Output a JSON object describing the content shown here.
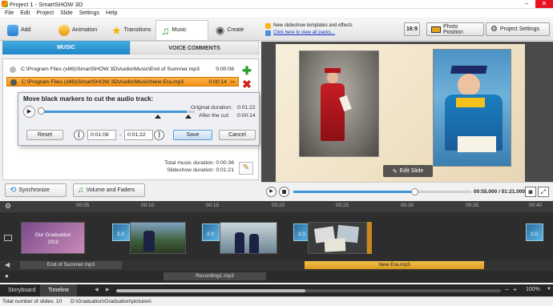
{
  "window": {
    "title": "Project 1 - SmartSHOW 3D",
    "minimize": "–",
    "close": "✕"
  },
  "menu": [
    "File",
    "Edit",
    "Project",
    "Slide",
    "Settings",
    "Help"
  ],
  "left_tabs": [
    {
      "label": "Add",
      "icon": "add-icon"
    },
    {
      "label": "Animation",
      "icon": "animation-icon"
    },
    {
      "label": "Transitions",
      "icon": "transitions-icon"
    },
    {
      "label": "Music",
      "icon": "music-icon"
    },
    {
      "label": "Create",
      "icon": "create-icon"
    }
  ],
  "subtabs": {
    "music": "MUSIC",
    "voice": "VOICE COMMENTS"
  },
  "tracks": [
    {
      "path": "C:\\Program Files (x86)\\SmartSHOW 3D\\Audio\\Music\\End of Summer.mp3",
      "duration": "0:00:08"
    },
    {
      "path": "C:\\Program Files (x86)\\SmartSHOW 3D\\Audio\\Music\\New Era.mp3",
      "duration": "0:00:14"
    }
  ],
  "totals": {
    "music_label": "Total music duration:",
    "music_value": "0:00:36",
    "slideshow_label": "Slideshow duration:",
    "slideshow_value": "0:01:21"
  },
  "dialog": {
    "title": "Move black markers to cut the audio track:",
    "original_label": "Original duration:",
    "original_value": "0:01:22",
    "after_label": "After the cut:",
    "after_value": "0:00:14",
    "reset": "Reset",
    "start_value": "0:01:08",
    "dash": "-",
    "end_value": "0:01:22",
    "left_bracket": "[",
    "right_bracket": "]",
    "save": "Save",
    "cancel": "Cancel"
  },
  "buttons": {
    "sync": "Synchronize",
    "volume": "Volume and Faders"
  },
  "right_top": {
    "link1": "New slideshow templates and effects",
    "link2": "Click here to view all packs...",
    "ratio": "16:9",
    "photo_position": "Photo Position",
    "project_settings": "Project Settings"
  },
  "preview": {
    "edit_slide": "Edit Slide"
  },
  "playback": {
    "time": "00:55.000 / 01:21.000",
    "progress": 0.68
  },
  "ruler_ticks": [
    "00:05",
    "00:10",
    "00:15",
    "00:20",
    "00:25",
    "00:30",
    "00:35",
    "00:40"
  ],
  "slides": {
    "first_title": "Our Graduation",
    "first_year": "2019",
    "transition_labels": [
      "2.0",
      "2.0",
      "2.0",
      "2.0",
      "2.0"
    ]
  },
  "audio": {
    "clip1": "End of Summer.mp3",
    "clip2": "New Era.mp3",
    "voice": "Recording1.mp3"
  },
  "bottom_tabs": {
    "storyboard": "Storyboard",
    "timeline": "Timeline",
    "zoom": "100%"
  },
  "status": {
    "slides": "Total number of slides: 10",
    "path": "D:\\Graduation\\Graduation\\pictures\\"
  },
  "colors": {
    "accent": "#1f87c8",
    "selected_track": "#f39012",
    "audio_clip": "#e8b33c",
    "timeline_bg": "#2d2d2d"
  }
}
